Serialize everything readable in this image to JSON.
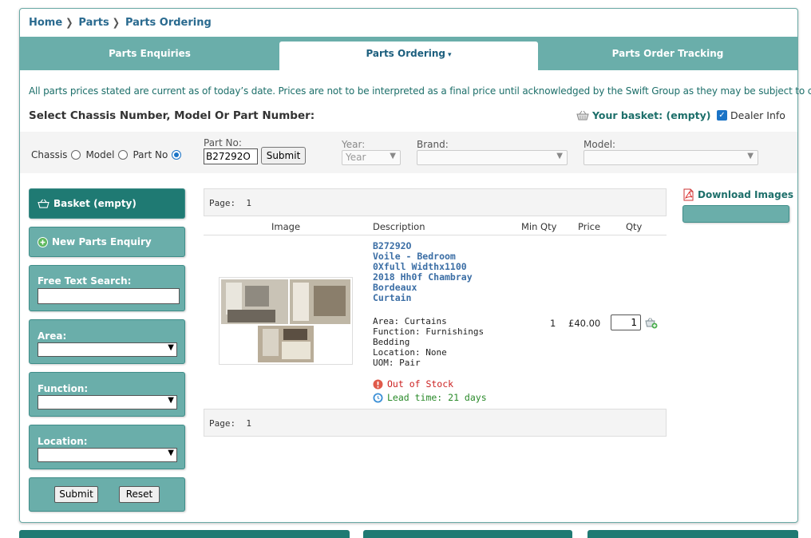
{
  "breadcrumb": {
    "home": "Home",
    "parts": "Parts",
    "current": "Parts Ordering"
  },
  "tabs": [
    {
      "label": "Parts Enquiries"
    },
    {
      "label": "Parts Ordering",
      "caret": "▾"
    },
    {
      "label": "Parts Order Tracking"
    }
  ],
  "notice": "All parts prices stated are current as of today’s date. Prices are not to be interpreted as a final price until acknowledged by the Swift Group as they may be subject to change.",
  "select_title": "Select Chassis Number, Model Or Part Number:",
  "basket_top": "Your basket: (empty)",
  "dealer_info": {
    "label": "Dealer Info",
    "checked": true
  },
  "search_mode": {
    "chassis": "Chassis",
    "model": "Model",
    "part_no": "Part No",
    "selected": "part_no"
  },
  "part_no": {
    "label": "Part No:",
    "value": "B27292O",
    "submit": "Submit"
  },
  "year": {
    "label": "Year:",
    "value": "Year"
  },
  "brand": {
    "label": "Brand:",
    "value": ""
  },
  "model": {
    "label": "Model:",
    "value": ""
  },
  "sidebar": {
    "basket": "Basket (empty)",
    "new_enquiry": "New Parts Enquiry",
    "free_text_label": "Free Text Search:",
    "free_text_value": "",
    "area_label": "Area:",
    "function_label": "Function:",
    "location_label": "Location:",
    "submit": "Submit",
    "reset": "Reset"
  },
  "results": {
    "page_label": "Page:",
    "page_number": "1",
    "columns": {
      "image": "Image",
      "description": "Description",
      "min_qty": "Min Qty",
      "price": "Price",
      "qty": "Qty"
    },
    "item": {
      "code": "B27292O",
      "name_lines": [
        "Voile - Bedroom",
        "0Xfull Widthx1100",
        "2018 Hh0f Chambray",
        "Bordeaux",
        "Curtain"
      ],
      "info_lines": [
        "Area: Curtains",
        "Function: Furnishings",
        "Bedding",
        "Location: None",
        "UOM: Pair"
      ],
      "stock_status": "Out of Stock",
      "lead_time": "Lead time: 21 days",
      "min_qty": "1",
      "price": "£40.00",
      "qty": "1"
    }
  },
  "download_images": "Download Images",
  "colors": {
    "teal": "#6aaeaa",
    "dark_teal": "#1f7a73",
    "link_blue": "#2a6a8f",
    "out_of_stock": "#cc2222",
    "lead_time": "#2a8a2a"
  }
}
